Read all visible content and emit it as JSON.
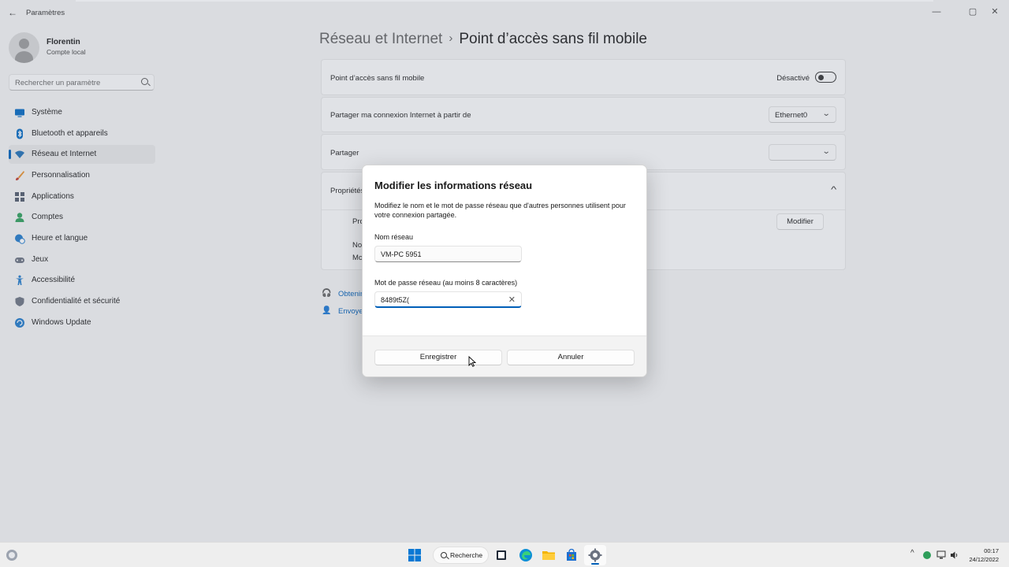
{
  "window": {
    "app_title": "Paramètres",
    "back_glyph": "←",
    "minimize_glyph": "—",
    "maximize_glyph": "▢",
    "close_glyph": "✕"
  },
  "profile": {
    "name": "Florentin",
    "subtitle": "Compte local"
  },
  "search": {
    "placeholder": "Rechercher un paramètre"
  },
  "sidebar": {
    "items": [
      {
        "label": "Système",
        "icon": "monitor-icon"
      },
      {
        "label": "Bluetooth et appareils",
        "icon": "bluetooth-icon"
      },
      {
        "label": "Réseau et Internet",
        "icon": "wifi-icon",
        "active": true
      },
      {
        "label": "Personnalisation",
        "icon": "brush-icon"
      },
      {
        "label": "Applications",
        "icon": "apps-icon"
      },
      {
        "label": "Comptes",
        "icon": "account-icon"
      },
      {
        "label": "Heure et langue",
        "icon": "globe-clock-icon"
      },
      {
        "label": "Jeux",
        "icon": "gamepad-icon"
      },
      {
        "label": "Accessibilité",
        "icon": "accessibility-icon"
      },
      {
        "label": "Confidentialité et sécurité",
        "icon": "shield-icon"
      },
      {
        "label": "Windows Update",
        "icon": "update-icon"
      }
    ]
  },
  "breadcrumb": {
    "parent": "Réseau et Internet",
    "separator": "›",
    "current": "Point d’accès sans fil mobile"
  },
  "settings": {
    "hotspot_label": "Point d’accès sans fil mobile",
    "hotspot_state": "Désactivé",
    "share_from_label": "Partager ma connexion Internet à partir de",
    "share_from_value": "Ethernet0",
    "share_over_label": "Partager",
    "share_over_value": "",
    "properties_label": "Propriétés",
    "properties_row1": "Pro",
    "properties_row2": "No",
    "properties_row3": "Mo",
    "modify_button": "Modifier",
    "chevron_down": "⌄",
    "chevron_up": "^"
  },
  "help": {
    "get_help": "Obtenir",
    "send_feedback": "Envoye"
  },
  "dialog": {
    "title": "Modifier les informations réseau",
    "description": "Modifiez le nom et le mot de passe réseau que d'autres personnes utilisent pour votre connexion partagée.",
    "network_name_label": "Nom réseau",
    "network_name_value": "VM-PC 5951",
    "password_label": "Mot de passe réseau (au moins 8 caractères)",
    "password_value": "8489t5Z(",
    "clear_glyph": "✕",
    "save_button": "Enregistrer",
    "cancel_button": "Annuler"
  },
  "taskbar": {
    "search_label": "Recherche",
    "tray_chevron": "^",
    "time": "00:17",
    "date": "24/12/2022"
  },
  "colors": {
    "accent": "#005fb8",
    "background": "#f3f3f3",
    "card": "#fbfbfb"
  }
}
